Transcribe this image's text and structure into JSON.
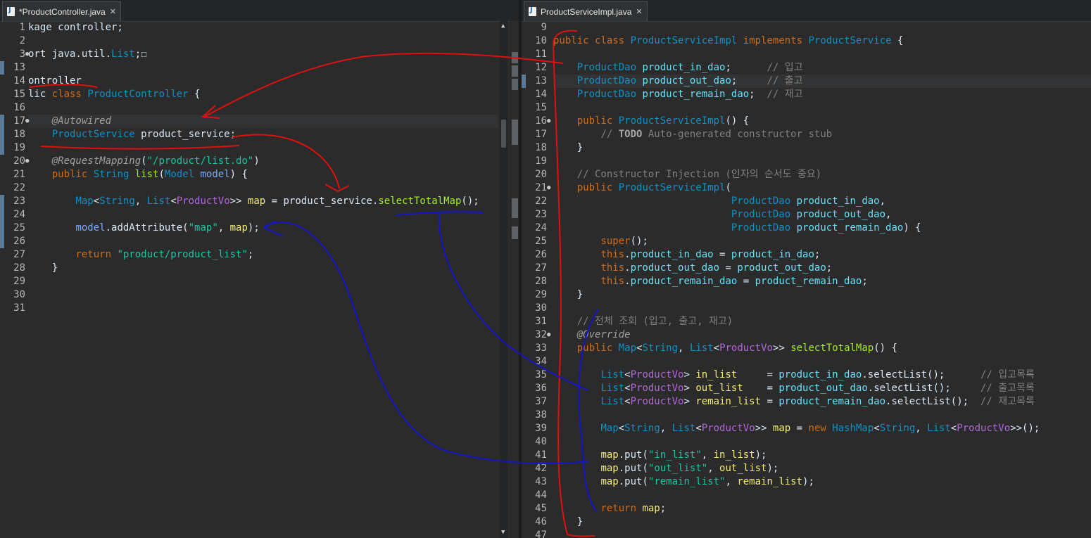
{
  "left_tab": {
    "title": "*ProductController.java"
  },
  "right_tab": {
    "title": "ProductServiceImpl.java"
  },
  "left_editor": {
    "lines": [
      {
        "n": "1",
        "text": "kage controller;"
      },
      {
        "n": "2",
        "text": ""
      },
      {
        "n": "3",
        "text": "ort java.util.List;☐"
      },
      {
        "n": "13",
        "text": ""
      },
      {
        "n": "14",
        "text": "ontroller"
      },
      {
        "n": "15",
        "text": "lic class ProductController {"
      },
      {
        "n": "16",
        "text": ""
      },
      {
        "n": "17",
        "text": "    @Autowired"
      },
      {
        "n": "18",
        "text": "    ProductService product_service;"
      },
      {
        "n": "19",
        "text": ""
      },
      {
        "n": "20",
        "text": "    @RequestMapping(\"/product/list.do\")"
      },
      {
        "n": "21",
        "text": "    public String list(Model model) {"
      },
      {
        "n": "22",
        "text": ""
      },
      {
        "n": "23",
        "text": "        Map<String, List<ProductVo>> map = product_service.selectTotalMap();"
      },
      {
        "n": "24",
        "text": ""
      },
      {
        "n": "25",
        "text": "        model.addAttribute(\"map\", map);"
      },
      {
        "n": "26",
        "text": ""
      },
      {
        "n": "27",
        "text": "        return \"product/product_list\";"
      },
      {
        "n": "28",
        "text": "    }"
      },
      {
        "n": "29",
        "text": ""
      },
      {
        "n": "30",
        "text": ""
      },
      {
        "n": "31",
        "text": ""
      }
    ]
  },
  "right_editor": {
    "lines": [
      {
        "n": "9",
        "text": ""
      },
      {
        "n": "10",
        "text": "public class ProductServiceImpl implements ProductService {"
      },
      {
        "n": "11",
        "text": ""
      },
      {
        "n": "12",
        "text": "    ProductDao product_in_dao;      // 입고"
      },
      {
        "n": "13",
        "text": "    ProductDao product_out_dao;     // 출고"
      },
      {
        "n": "14",
        "text": "    ProductDao product_remain_dao;  // 재고"
      },
      {
        "n": "15",
        "text": ""
      },
      {
        "n": "16",
        "text": "    public ProductServiceImpl() {"
      },
      {
        "n": "17",
        "text": "        // TODO Auto-generated constructor stub"
      },
      {
        "n": "18",
        "text": "    }"
      },
      {
        "n": "19",
        "text": ""
      },
      {
        "n": "20",
        "text": "    // Constructor Injection (인자의 순서도 중요)"
      },
      {
        "n": "21",
        "text": "    public ProductServiceImpl("
      },
      {
        "n": "22",
        "text": "                              ProductDao product_in_dao,"
      },
      {
        "n": "23",
        "text": "                              ProductDao product_out_dao,"
      },
      {
        "n": "24",
        "text": "                              ProductDao product_remain_dao) {"
      },
      {
        "n": "25",
        "text": "        super();"
      },
      {
        "n": "26",
        "text": "        this.product_in_dao = product_in_dao;"
      },
      {
        "n": "27",
        "text": "        this.product_out_dao = product_out_dao;"
      },
      {
        "n": "28",
        "text": "        this.product_remain_dao = product_remain_dao;"
      },
      {
        "n": "29",
        "text": "    }"
      },
      {
        "n": "30",
        "text": ""
      },
      {
        "n": "31",
        "text": "    // 전체 조회 (입고, 출고, 재고)"
      },
      {
        "n": "32",
        "text": "    @Override"
      },
      {
        "n": "33",
        "text": "    public Map<String, List<ProductVo>> selectTotalMap() {"
      },
      {
        "n": "34",
        "text": ""
      },
      {
        "n": "35",
        "text": "        List<ProductVo> in_list     = product_in_dao.selectList();      // 입고목록"
      },
      {
        "n": "36",
        "text": "        List<ProductVo> out_list    = product_out_dao.selectList();     // 출고목록"
      },
      {
        "n": "37",
        "text": "        List<ProductVo> remain_list = product_remain_dao.selectList();  // 재고목록"
      },
      {
        "n": "38",
        "text": ""
      },
      {
        "n": "39",
        "text": "        Map<String, List<ProductVo>> map = new HashMap<String, List<ProductVo>>();"
      },
      {
        "n": "40",
        "text": ""
      },
      {
        "n": "41",
        "text": "        map.put(\"in_list\", in_list);"
      },
      {
        "n": "42",
        "text": "        map.put(\"out_list\", out_list);"
      },
      {
        "n": "43",
        "text": "        map.put(\"remain_list\", remain_list);"
      },
      {
        "n": "44",
        "text": ""
      },
      {
        "n": "45",
        "text": "        return map;"
      },
      {
        "n": "46",
        "text": "    }"
      },
      {
        "n": "47",
        "text": ""
      }
    ]
  },
  "colors": {
    "editor_bg": "#2b2b2b",
    "keyword": "#cc6c1d",
    "type": "#1290c3",
    "string": "#17c6a3",
    "red_annotation": "#e01010",
    "blue_annotation": "#1414c8"
  }
}
